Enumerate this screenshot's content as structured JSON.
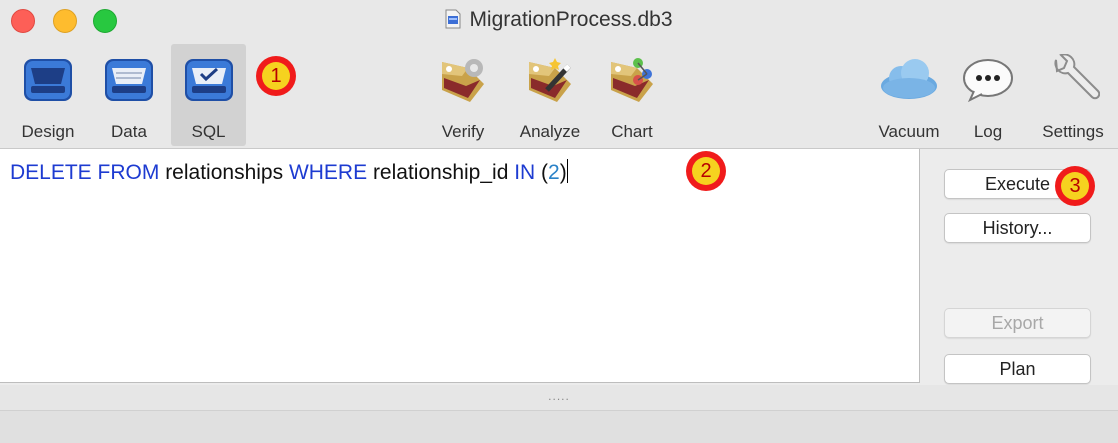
{
  "window": {
    "title": "MigrationProcess.db3",
    "controls": [
      "close",
      "minimize",
      "zoom"
    ]
  },
  "toolbar": {
    "left_items": [
      {
        "label": "Design",
        "icon": "design-icon",
        "selected": false
      },
      {
        "label": "Data",
        "icon": "data-icon",
        "selected": false
      },
      {
        "label": "SQL",
        "icon": "sql-icon",
        "selected": true
      }
    ],
    "center_items": [
      {
        "label": "Verify",
        "icon": "verify-icon"
      },
      {
        "label": "Analyze",
        "icon": "analyze-icon"
      },
      {
        "label": "Chart",
        "icon": "chart-icon"
      }
    ],
    "right_items": [
      {
        "label": "Vacuum",
        "icon": "cloud-icon"
      },
      {
        "label": "Log",
        "icon": "speech-bubble-icon"
      },
      {
        "label": "Settings",
        "icon": "wrench-icon"
      }
    ]
  },
  "editor": {
    "sql": {
      "kw1": "DELETE FROM",
      "t1": " relationships ",
      "kw2": "WHERE",
      "t2": " relationship_id ",
      "kw3": "IN",
      "t3": " (",
      "num": "2",
      "t4": ")"
    }
  },
  "actions": {
    "execute": "Execute",
    "history": "History...",
    "export": "Export",
    "plan": "Plan"
  },
  "splitter_handle": ".....",
  "markers": [
    "1",
    "2",
    "3"
  ],
  "colors": {
    "keyword": "#1d3bd1",
    "number": "#2a82c8",
    "marker_red": "#f01b1b",
    "marker_yellow": "#f6d21f"
  }
}
